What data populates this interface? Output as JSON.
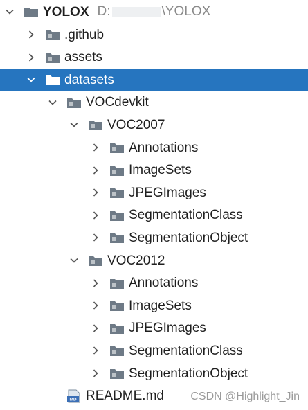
{
  "colors": {
    "selected_bg": "#2675bf",
    "folder": "#6e7a86",
    "folder_selected": "#ffffff"
  },
  "root": {
    "label": "YOLOX",
    "path_prefix": "D:",
    "path_suffix": "\\YOLOX"
  },
  "tree": [
    {
      "label": ".github",
      "depth": 1,
      "expandable": true,
      "expanded": false,
      "icon": "folder-icon"
    },
    {
      "label": "assets",
      "depth": 1,
      "expandable": true,
      "expanded": false,
      "icon": "folder-icon"
    },
    {
      "label": "datasets",
      "depth": 1,
      "expandable": true,
      "expanded": true,
      "icon": "folder-icon",
      "selected": true
    },
    {
      "label": "VOCdevkit",
      "depth": 2,
      "expandable": true,
      "expanded": true,
      "icon": "folder-icon"
    },
    {
      "label": "VOC2007",
      "depth": 3,
      "expandable": true,
      "expanded": true,
      "icon": "folder-icon"
    },
    {
      "label": "Annotations",
      "depth": 4,
      "expandable": true,
      "expanded": false,
      "icon": "folder-icon"
    },
    {
      "label": "ImageSets",
      "depth": 4,
      "expandable": true,
      "expanded": false,
      "icon": "folder-icon"
    },
    {
      "label": "JPEGImages",
      "depth": 4,
      "expandable": true,
      "expanded": false,
      "icon": "folder-icon"
    },
    {
      "label": "SegmentationClass",
      "depth": 4,
      "expandable": true,
      "expanded": false,
      "icon": "folder-icon"
    },
    {
      "label": "SegmentationObject",
      "depth": 4,
      "expandable": true,
      "expanded": false,
      "icon": "folder-icon"
    },
    {
      "label": "VOC2012",
      "depth": 3,
      "expandable": true,
      "expanded": true,
      "icon": "folder-icon"
    },
    {
      "label": "Annotations",
      "depth": 4,
      "expandable": true,
      "expanded": false,
      "icon": "folder-icon"
    },
    {
      "label": "ImageSets",
      "depth": 4,
      "expandable": true,
      "expanded": false,
      "icon": "folder-icon"
    },
    {
      "label": "JPEGImages",
      "depth": 4,
      "expandable": true,
      "expanded": false,
      "icon": "folder-icon"
    },
    {
      "label": "SegmentationClass",
      "depth": 4,
      "expandable": true,
      "expanded": false,
      "icon": "folder-icon"
    },
    {
      "label": "SegmentationObject",
      "depth": 4,
      "expandable": true,
      "expanded": false,
      "icon": "folder-icon"
    },
    {
      "label": "README.md",
      "depth": 2,
      "expandable": false,
      "expanded": false,
      "icon": "markdown-file-icon",
      "badge": "MD"
    }
  ],
  "watermark": "CSDN @Highlight_Jin"
}
